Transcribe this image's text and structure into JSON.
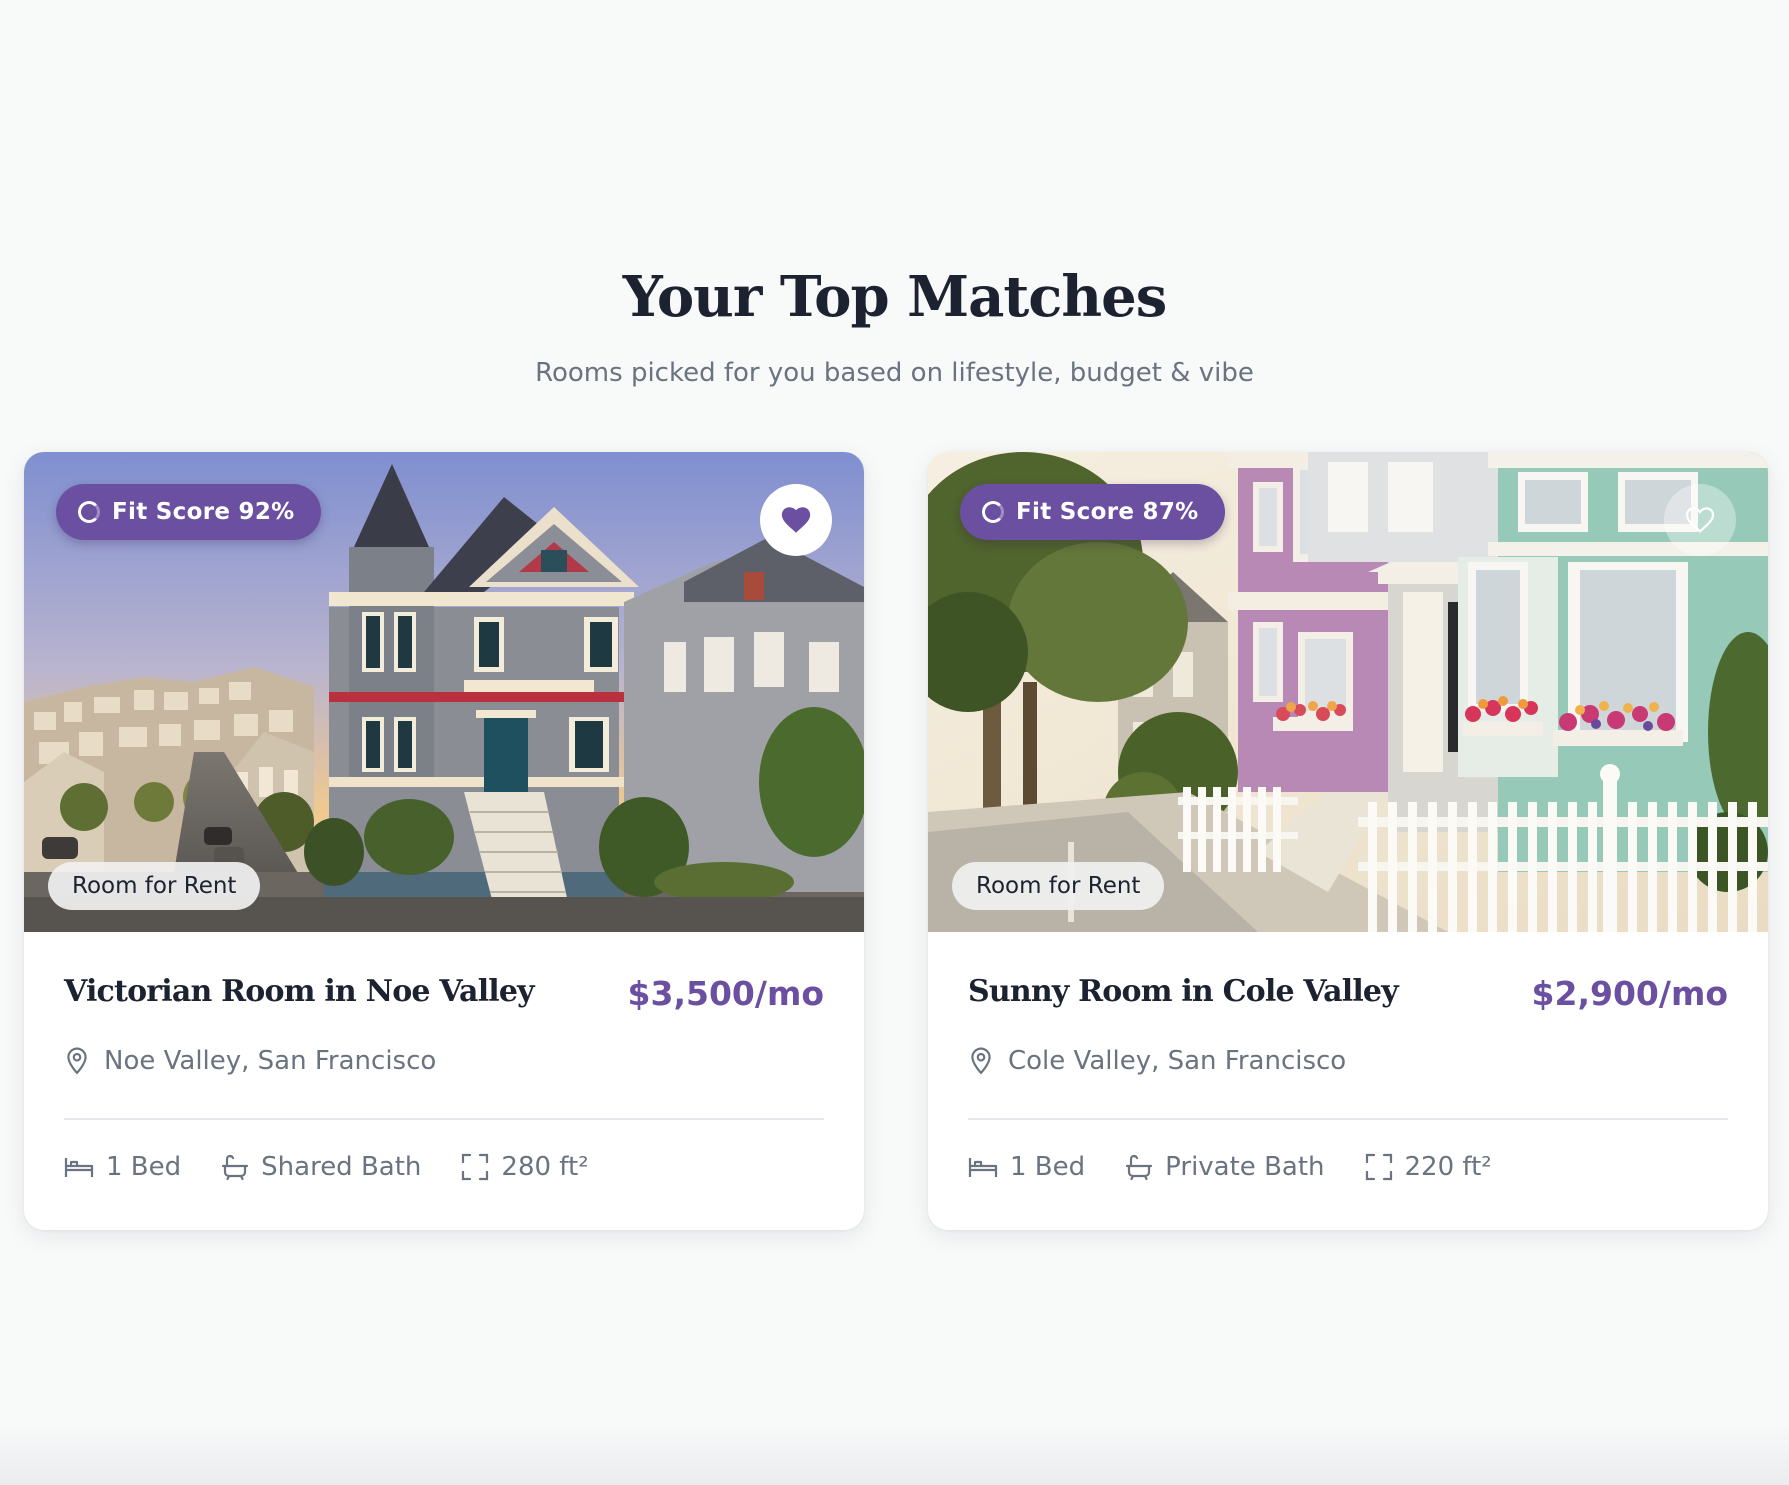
{
  "header": {
    "title": "Your Top Matches",
    "subtitle": "Rooms picked for you based on lifestyle, budget & vibe"
  },
  "colors": {
    "accent": "#6b4fa0",
    "page_background": "#f8f9f9",
    "muted_text": "#6b7280"
  },
  "listings": [
    {
      "fit_score": "Fit Score 92%",
      "type": "Room for Rent",
      "title": "Victorian Room in Noe Valley",
      "price": "$3,500/mo",
      "location": "Noe Valley, San Francisco",
      "favorited": true,
      "features": {
        "beds": "1 Bed",
        "bath": "Shared Bath",
        "area": "280 ft²"
      },
      "icons": [
        "fit-ring-icon",
        "heart-icon",
        "location-pin-icon",
        "bed-icon",
        "bathtub-icon",
        "area-expand-icon"
      ]
    },
    {
      "fit_score": "Fit Score 87%",
      "type": "Room for Rent",
      "title": "Sunny Room in Cole Valley",
      "price": "$2,900/mo",
      "location": "Cole Valley, San Francisco",
      "favorited": false,
      "features": {
        "beds": "1 Bed",
        "bath": "Private Bath",
        "area": "220 ft²"
      },
      "icons": [
        "fit-ring-icon",
        "heart-outline-icon",
        "location-pin-icon",
        "bed-icon",
        "bathtub-icon",
        "area-expand-icon"
      ]
    }
  ]
}
